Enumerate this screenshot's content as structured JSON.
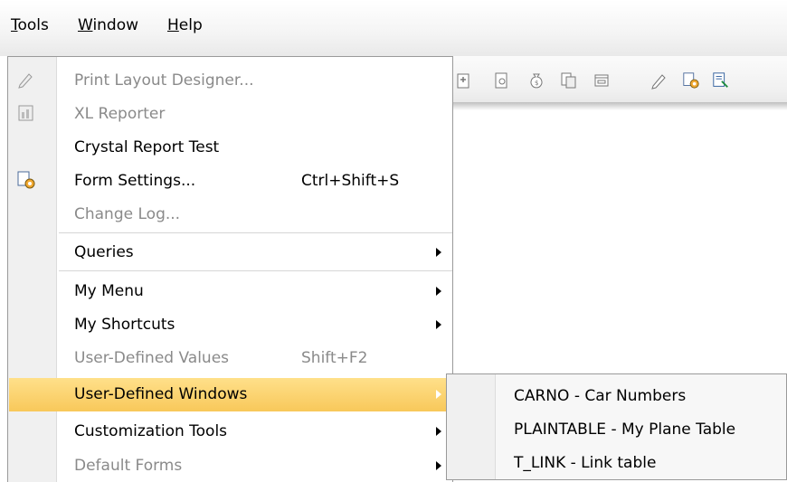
{
  "menubar": {
    "items": [
      {
        "label": "Tools"
      },
      {
        "label": "Window"
      },
      {
        "label": "Help"
      }
    ]
  },
  "toolbar": {
    "icons": [
      "import-icon",
      "calculator-icon",
      "money-bag-icon",
      "document-copy-icon",
      "window-icon",
      "pencil-icon",
      "form-settings-icon",
      "query-icon"
    ]
  },
  "tools_menu": {
    "items": [
      {
        "label": "Print Layout Designer...",
        "shortcut": "",
        "disabled": true,
        "icon": "pencil-icon"
      },
      {
        "label": "XL Reporter",
        "shortcut": "",
        "disabled": true,
        "icon": "xl-reporter-icon"
      },
      {
        "label": "Crystal Report Test",
        "shortcut": "",
        "disabled": false
      },
      {
        "label": "Form Settings...",
        "shortcut": "Ctrl+Shift+S",
        "disabled": false,
        "icon": "form-settings-icon"
      },
      {
        "label": "Change Log...",
        "shortcut": "",
        "disabled": true
      },
      {
        "label": "Queries",
        "submenu": true
      },
      {
        "label": "My Menu",
        "submenu": true
      },
      {
        "label": "My Shortcuts",
        "submenu": true
      },
      {
        "label": "User-Defined Values",
        "shortcut": "Shift+F2",
        "disabled": true
      },
      {
        "label": "User-Defined Windows",
        "submenu": true,
        "highlighted": true
      },
      {
        "label": "Customization Tools",
        "submenu": true
      },
      {
        "label": "Default Forms",
        "submenu": true
      }
    ]
  },
  "udw_submenu": {
    "items": [
      {
        "label": "CARNO - Car Numbers"
      },
      {
        "label": "PLAINTABLE - My Plane Table"
      },
      {
        "label": "T_LINK - Link table"
      }
    ]
  },
  "colors": {
    "highlight": "#f8c85a",
    "disabled_text": "#8a8a8a"
  }
}
